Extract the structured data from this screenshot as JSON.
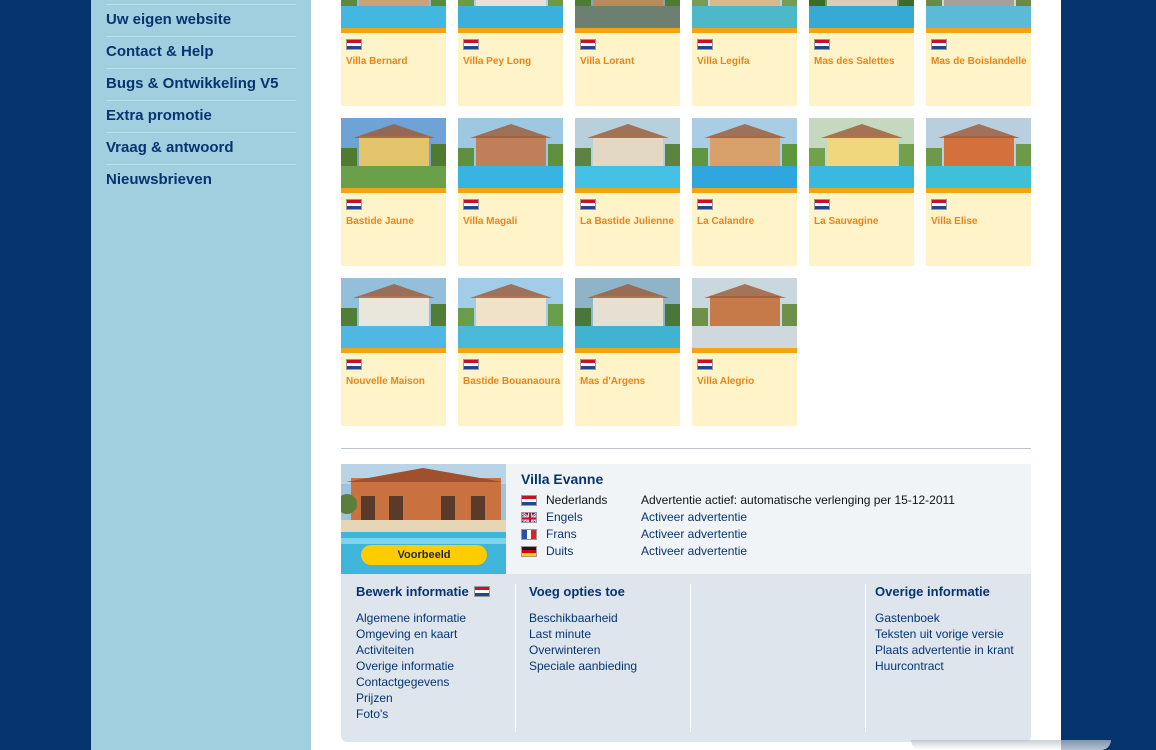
{
  "sidebar": {
    "items": [
      {
        "label": "Uw eigen website"
      },
      {
        "label": "Contact & Help"
      },
      {
        "label": "Bugs & Ontwikkeling V5"
      },
      {
        "label": "Extra promotie"
      },
      {
        "label": "Vraag & antwoord"
      },
      {
        "label": "Nieuwsbrieven"
      }
    ]
  },
  "villas": [
    {
      "name": "Villa Bernard"
    },
    {
      "name": "Villa Pey Long"
    },
    {
      "name": "Villa Lorant"
    },
    {
      "name": "Villa Legifa"
    },
    {
      "name": "Mas des Salettes"
    },
    {
      "name": "Mas de Boislandelle"
    },
    {
      "name": "Bastide Jaune"
    },
    {
      "name": "Villa Magali"
    },
    {
      "name": "La Bastide Julienne"
    },
    {
      "name": "La Calandre"
    },
    {
      "name": "La Sauvagine"
    },
    {
      "name": "Villa Elise"
    },
    {
      "name": "Nouvelle Maison"
    },
    {
      "name": "Bastide Bouanaoura"
    },
    {
      "name": "Mas d'Argens"
    },
    {
      "name": "Villa Alegrio"
    }
  ],
  "listing": {
    "title": "Villa Evanne",
    "preview_label": "Voorbeeld",
    "languages": [
      {
        "name": "Nederlands",
        "status": "Advertentie actief: automatische verlenging per 15-12-2011",
        "flag": "nl-flag-icon"
      },
      {
        "name": "Engels",
        "status": "Activeer advertentie",
        "flag": "uk-flag-icon"
      },
      {
        "name": "Frans",
        "status": "Activeer advertentie",
        "flag": "fr-flag-icon"
      },
      {
        "name": "Duits",
        "status": "Activeer advertentie",
        "flag": "de-flag-icon"
      }
    ]
  },
  "edit": {
    "heading": "Bewerk informatie",
    "links": [
      "Algemene informatie",
      "Omgeving en kaart",
      "Activiteiten",
      "Overige informatie",
      "Contactgegevens",
      "Prijzen",
      "Foto's"
    ]
  },
  "options": {
    "heading": "Voeg opties toe",
    "links": [
      "Beschikbaarheid",
      "Last minute",
      "Overwinteren",
      "Speciale aanbieding"
    ]
  },
  "other": {
    "heading": "Overige informatie",
    "links": [
      "Gastenboek",
      "Teksten uit vorige versie",
      "Plaats advertentie in krant",
      "Huurcontract"
    ]
  },
  "colors": {
    "background": "#06346f",
    "sidebar": "#a2cfdf",
    "card": "#fff3c9",
    "card_bar": "#f3a414",
    "villa_name": "#e7861c",
    "link": "#06346f",
    "preview_button": "#ffcc00"
  }
}
